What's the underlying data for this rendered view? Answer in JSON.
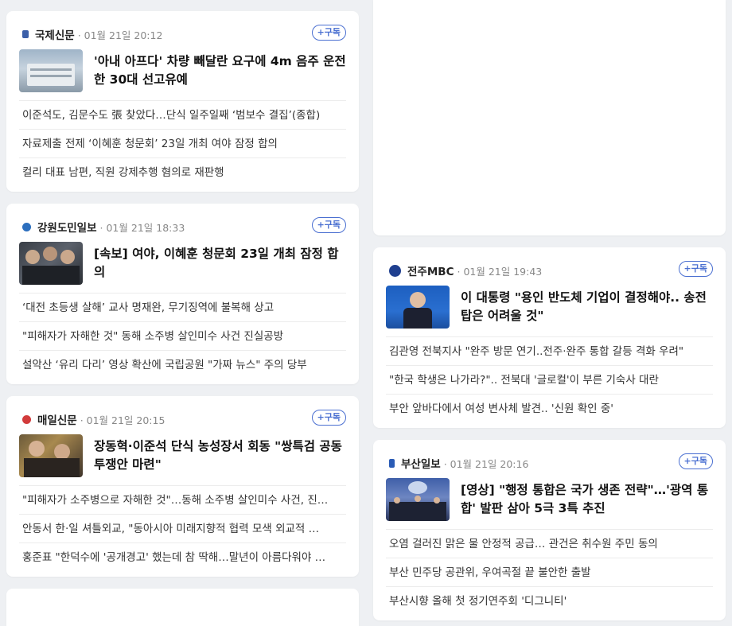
{
  "cards": [
    {
      "press": "국제신문",
      "time": "01월 21일 20:12",
      "subscribe": "+구독",
      "logo_color": "#3b5fa8",
      "headline": "'아내 아프다' 차량 빼달란 요구에 4m 음주 운전한 30대 선고유예",
      "items": [
        "이준석도, 김문수도 張 찾았다…단식 일주일째 ‘범보수 결집’(종합)",
        "자료제출 전제 ‘이혜훈 청문회’ 23일 개최 여야 잠정 합의",
        "컬리 대표 남편, 직원 강제추행 혐의로 재판행"
      ]
    },
    {
      "press": "강원도민일보",
      "time": "01월 21일 18:33",
      "subscribe": "+구독",
      "logo_color": "#2c6fbe",
      "headline": "[속보] 여야, 이혜훈 청문회 23일 개최 잠정 합의",
      "items": [
        "‘대전 초등생 살해’ 교사 명재완, 무기징역에 불복해 상고",
        "\"피해자가 자해한 것\" 동해 소주병 살인미수 사건 진실공방",
        "설악산 ‘유리 다리’ 영상 확산에 국립공원 \"가짜 뉴스\" 주의 당부"
      ]
    },
    {
      "press": "매일신문",
      "time": "01월 21일 20:15",
      "subscribe": "+구독",
      "logo_color": "#d23b3b",
      "headline": "장동혁·이준석 단식 농성장서 회동 \"쌍특검 공동투쟁안 마련\"",
      "items": [
        "\"피해자가 소주병으로 자해한 것\"…동해 소주병 살인미수 사건, 진…",
        "안동서 한·일 셔틀외교, \"동아시아 미래지향적 협력 모색 외교적 …",
        "홍준표 \"한덕수에 '공개경고' 했는데 참 딱해…말년이 아름다워야 …"
      ]
    },
    {
      "press": "전주MBC",
      "time": "01월 21일 19:43",
      "subscribe": "+구독",
      "logo_color": "#1f3f8f",
      "headline": "이 대통령 \"용인 반도체 기업이 결정해야.. 송전탑은 어려울 것\"",
      "items": [
        "김관영 전북지사 \"완주 방문 연기..전주·완주 통합 갈등 격화 우려\"",
        "\"한국 학생은 나가라?\".. 전북대 '글로컬'이 부른 기숙사 대란",
        "부안 앞바다에서 여성 변사체 발견.. '신원 확인 중'"
      ]
    },
    {
      "press": "부산일보",
      "time": "01월 21일 20:16",
      "subscribe": "+구독",
      "logo_color": "#2a5bb5",
      "headline": "[영상] \"행정 통합은 국가 생존 전략\"…'광역 통합' 발판 삼아 5극 3특 추진",
      "items": [
        "오염 걸러진 맑은 물 안정적 공급… 관건은 취수원 주민 동의",
        "부산 민주당 공관위, 우여곡절 끝 불안한 출발",
        "부산시향 올해 첫 정기연주회 '디그니티'"
      ]
    }
  ]
}
